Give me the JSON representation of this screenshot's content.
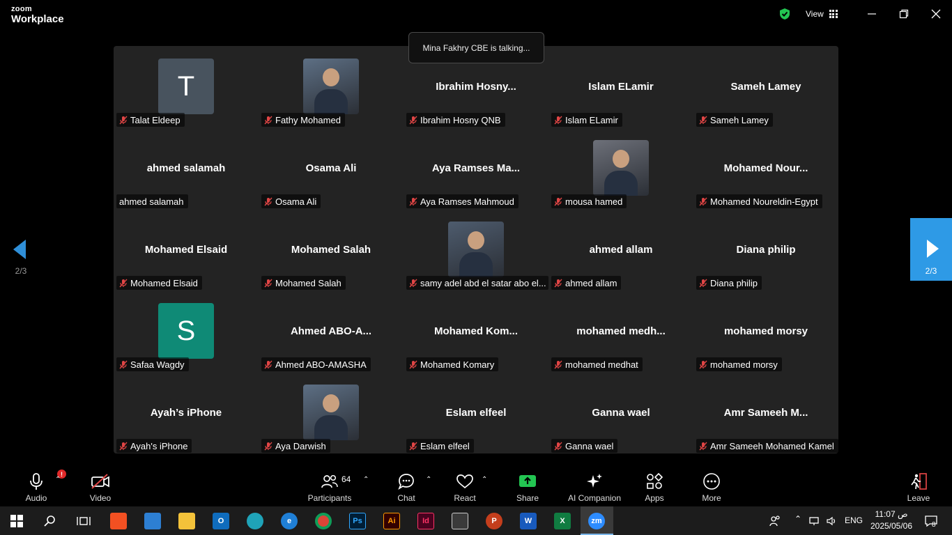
{
  "app": {
    "brand_top": "zoom",
    "brand_bottom": "Workplace",
    "view_label": "View"
  },
  "banner": {
    "talking": "Mina Fakhry CBE is talking..."
  },
  "pager": {
    "left_page": "2/3",
    "right_page": "2/3"
  },
  "tiles": [
    {
      "label": "Talat Eldeep",
      "big": "",
      "avatar_letter": "T",
      "avatar_color": "#48535e",
      "muted": true
    },
    {
      "label": "Fathy Mohamed",
      "big": "",
      "avatar_letter": "",
      "avatar_color": "photo",
      "muted": true
    },
    {
      "label": "Ibrahim Hosny QNB",
      "big": "Ibrahim  Hosny...",
      "avatar_letter": "",
      "avatar_color": "",
      "muted": true
    },
    {
      "label": "Islam ELamir",
      "big": "Islam ELamir",
      "avatar_letter": "",
      "avatar_color": "",
      "muted": true
    },
    {
      "label": "Sameh Lamey",
      "big": "Sameh Lamey",
      "avatar_letter": "",
      "avatar_color": "",
      "muted": true
    },
    {
      "label": "ahmed salamah",
      "big": "ahmed salamah",
      "avatar_letter": "",
      "avatar_color": "",
      "muted": false
    },
    {
      "label": "Osama Ali",
      "big": "Osama Ali",
      "avatar_letter": "",
      "avatar_color": "",
      "muted": true
    },
    {
      "label": "Aya Ramses Mahmoud",
      "big": "Aya Ramses Ma...",
      "avatar_letter": "",
      "avatar_color": "",
      "muted": true
    },
    {
      "label": "mousa hamed",
      "big": "",
      "avatar_letter": "",
      "avatar_color": "photo",
      "muted": true
    },
    {
      "label": "Mohamed Noureldin-Egypt",
      "big": "Mohamed  Nour...",
      "avatar_letter": "",
      "avatar_color": "",
      "muted": true
    },
    {
      "label": "Mohamed Elsaid",
      "big": "Mohamed Elsaid",
      "avatar_letter": "",
      "avatar_color": "",
      "muted": true
    },
    {
      "label": "Mohamed Salah",
      "big": "Mohamed Salah",
      "avatar_letter": "",
      "avatar_color": "",
      "muted": true
    },
    {
      "label": "samy adel abd el satar abo el...",
      "big": "",
      "avatar_letter": "",
      "avatar_color": "photo",
      "muted": true
    },
    {
      "label": "ahmed allam",
      "big": "ahmed allam",
      "avatar_letter": "",
      "avatar_color": "",
      "muted": true
    },
    {
      "label": "Diana philip",
      "big": "Diana philip",
      "avatar_letter": "",
      "avatar_color": "",
      "muted": true
    },
    {
      "label": "Safaa Wagdy",
      "big": "",
      "avatar_letter": "S",
      "avatar_color": "#0f8a76",
      "muted": true
    },
    {
      "label": "Ahmed ABO-AMASHA",
      "big": "Ahmed ABO-A...",
      "avatar_letter": "",
      "avatar_color": "",
      "muted": true
    },
    {
      "label": "Mohamed Komary",
      "big": "Mohamed  Kom...",
      "avatar_letter": "",
      "avatar_color": "",
      "muted": true
    },
    {
      "label": "mohamed medhat",
      "big": "mohamed  medh...",
      "avatar_letter": "",
      "avatar_color": "",
      "muted": true
    },
    {
      "label": "mohamed morsy",
      "big": "mohamed morsy",
      "avatar_letter": "",
      "avatar_color": "",
      "muted": true
    },
    {
      "label": "Ayah's iPhone",
      "big": "Ayah’s iPhone",
      "avatar_letter": "",
      "avatar_color": "",
      "muted": true
    },
    {
      "label": "Aya Darwish",
      "big": "",
      "avatar_letter": "",
      "avatar_color": "photo",
      "muted": true
    },
    {
      "label": "Eslam elfeel",
      "big": "Eslam elfeel",
      "avatar_letter": "",
      "avatar_color": "",
      "muted": true
    },
    {
      "label": "Ganna wael",
      "big": "Ganna wael",
      "avatar_letter": "",
      "avatar_color": "",
      "muted": true
    },
    {
      "label": "Amr Sameeh Mohamed Kamel",
      "big": "Amr Sameeh  M...",
      "avatar_letter": "",
      "avatar_color": "",
      "muted": true
    }
  ],
  "toolbar": {
    "audio": "Audio",
    "audio_badge": "!",
    "video": "Video",
    "participants": "Participants",
    "participants_count": "64",
    "chat": "Chat",
    "react": "React",
    "share": "Share",
    "ai": "AI Companion",
    "apps": "Apps",
    "more": "More",
    "leave": "Leave"
  },
  "taskbar": {
    "lang": "ENG",
    "time": "11:07 ص",
    "date": "2025/05/06",
    "notifications": "8"
  },
  "colors": {
    "accent": "#2e9ae6",
    "share_green": "#23c552",
    "muted_red": "#e04545"
  }
}
